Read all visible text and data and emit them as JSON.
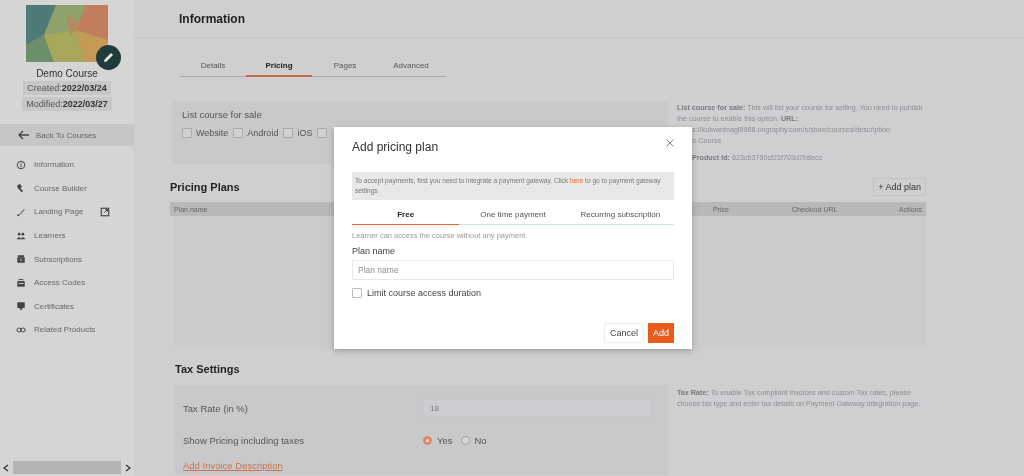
{
  "sidebar": {
    "course_title": "Demo Course",
    "created_label": "Created:",
    "created": "2022/03/24",
    "modified_label": "Modified:",
    "modified": "2022/03/27",
    "back": "Back To Courses",
    "items": [
      {
        "label": "Information",
        "kind": "info",
        "external_link": false
      },
      {
        "label": "Course Builder",
        "kind": "wrench",
        "external_link": false
      },
      {
        "label": "Landing Page",
        "kind": "brush",
        "external_link": true
      },
      {
        "label": "Learners",
        "kind": "people",
        "external_link": false
      },
      {
        "label": "Subscriptions",
        "kind": "box",
        "external_link": false
      },
      {
        "label": "Access Codes",
        "kind": "case",
        "external_link": false
      },
      {
        "label": "Certificates",
        "kind": "monitor",
        "external_link": false
      },
      {
        "label": "Related Products",
        "kind": "link",
        "external_link": false
      }
    ]
  },
  "main": {
    "title": "Information",
    "tabs": [
      {
        "label": "Details",
        "selected": false
      },
      {
        "label": "Pricing",
        "selected": true
      },
      {
        "label": "Pages",
        "selected": false
      },
      {
        "label": "Advanced",
        "selected": false
      }
    ],
    "sale": {
      "label": "List course for sale",
      "options": [
        {
          "label": "Website",
          "checked": false
        },
        {
          "label": "Android",
          "checked": false
        },
        {
          "label": "iOS",
          "checked": false
        },
        {
          "checked": false
        }
      ]
    },
    "sale_info": {
      "text": "**List course for sale:** This will list your course for selling. You need to publish the course to enable this option. **URL:**",
      "url": "s://kulwantnagi8988.ongraphy.com/s/store/courses/description",
      "url_tail": "o-Course",
      "product_label": "Product Id:",
      "product_id": "623cb3750cf21f703d7b8ecc"
    },
    "pricing": {
      "title": "Pricing Plans",
      "add_button": "+ Add plan",
      "columns": [
        "Plan name",
        "Price",
        "Checkout URL",
        "Actions"
      ]
    },
    "tax": {
      "title": "Tax Settings",
      "rate_label": "Tax Rate (in %)",
      "rate_value": "18",
      "show_label": "Show Pricing including taxes",
      "options": [
        {
          "label": "Yes",
          "selected": true
        },
        {
          "label": "No",
          "selected": false
        }
      ],
      "link": "Add Invoice Description",
      "info": "**Tax Rate:** To enable Tax compliant invoices and custom Tax rates, please choose tax type and enter tax details on Payment Gateway integration page."
    }
  },
  "dialog": {
    "title": "Add pricing plan",
    "banner_before": "To accept payments, first you need to integrate a payment gateway. Click ",
    "banner_link": "here",
    "banner_after": " to go to payment gateway settings",
    "tabs": [
      {
        "label": "Free",
        "selected": true
      },
      {
        "label": "One time payment",
        "selected": false
      },
      {
        "label": "Recurring subscription",
        "selected": false
      }
    ],
    "help": "Learner can access the course without any payment.",
    "field_label": "Plan name",
    "placeholder": "Plan name",
    "limit": {
      "label": "Limit course access duration",
      "checked": false
    },
    "cancel": "Cancel",
    "add": "Add"
  }
}
